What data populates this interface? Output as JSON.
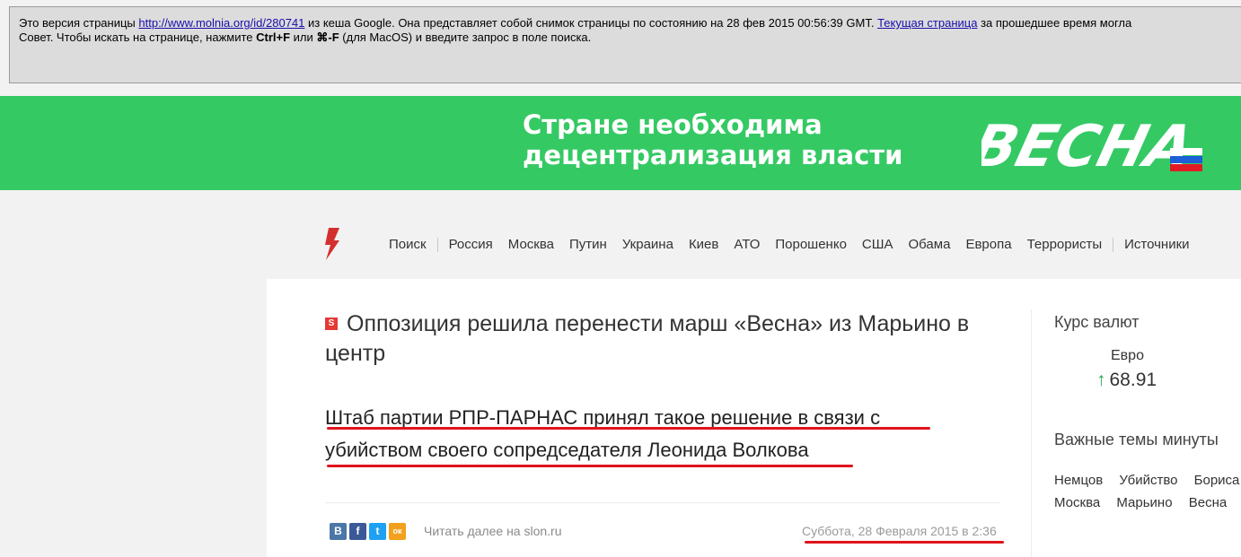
{
  "cache_bar": {
    "line1_prefix": "Это версия страницы ",
    "url": "http://www.molnia.org/id/280741",
    "line1_mid": " из кеша Google. Она представляет собой снимок страницы по состоянию на 28 фев 2015 00:56:39 GMT. ",
    "current_link": "Текущая страница",
    "line1_suffix": " за прошедшее время могла",
    "tip_prefix": "Совет. Чтобы искать на странице, нажмите ",
    "tip_key1": "Ctrl+F",
    "tip_or": " или ",
    "tip_key2": "⌘-F",
    "tip_suffix": " (для MacOS) и введите запрос в поле поиска."
  },
  "banner": {
    "line1": "Стране необходима",
    "line2": "децентрализация власти",
    "logo": "ВЕСНА",
    "color": "#35c964"
  },
  "nav": {
    "items": [
      "Поиск",
      "Россия",
      "Москва",
      "Путин",
      "Украина",
      "Киев",
      "АТО",
      "Порошенко",
      "США",
      "Обама",
      "Европа",
      "Террористы",
      "Источники"
    ]
  },
  "article": {
    "source_badge": "S",
    "headline": "Оппозиция решила перенести марш «Весна» из Марьино в центр",
    "lead": "Штаб партии РПР-ПАРНАС принял такое решение в связи с убийством своего сопредседателя Леонида Волкова",
    "social": [
      {
        "label": "В",
        "color": "#4a76a8"
      },
      {
        "label": "f",
        "color": "#3b5998"
      },
      {
        "label": "t",
        "color": "#1da1f2"
      },
      {
        "label": "ок",
        "color": "#f2a01d"
      }
    ],
    "read_more": "Читать далее на slon.ru",
    "date": "Суббота, 28 Февраля 2015 в 2:36"
  },
  "sidebar": {
    "currency_title": "Курс валют",
    "currency_name": "Евро",
    "currency_arrow": "↑",
    "currency_value": "68.91",
    "topics_title": "Важные темы минуты",
    "topics_row1": [
      "Немцов",
      "Убийство",
      "Бориса"
    ],
    "topics_row2": [
      "Москва",
      "Марьино",
      "Весна"
    ]
  }
}
